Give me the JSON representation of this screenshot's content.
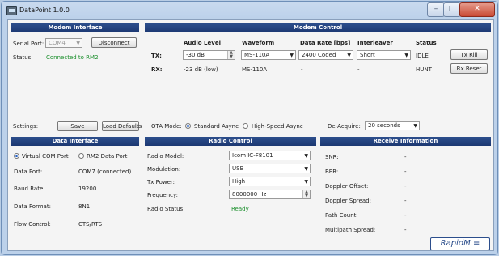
{
  "window": {
    "title": "DataPoint 1.0.0"
  },
  "modem_interface": {
    "header": "Modem Interface",
    "serial_port_label": "Serial Port:",
    "serial_port_value": "COM4",
    "disconnect_label": "Disconnect",
    "status_label": "Status:",
    "status_value": "Connected to RM2.",
    "settings_label": "Settings:",
    "save_label": "Save",
    "load_defaults_label": "Load Defaults"
  },
  "modem_control": {
    "header": "Modem Control",
    "columns": {
      "audio_level": "Audio Level",
      "waveform": "Waveform",
      "data_rate": "Data Rate [bps]",
      "interleaver": "Interleaver",
      "status": "Status"
    },
    "tx": {
      "label": "TX:",
      "audio_level": "-30 dB",
      "waveform": "MS-110A",
      "data_rate": "2400 Coded",
      "interleaver": "Short",
      "status": "IDLE",
      "button": "Tx Kill"
    },
    "rx": {
      "label": "RX:",
      "audio_level": "-23 dB (low)",
      "waveform": "MS-110A",
      "data_rate": "-",
      "interleaver": "-",
      "status": "HUNT",
      "button": "Rx Reset"
    },
    "ota_mode_label": "OTA Mode:",
    "ota_standard": "Standard Async",
    "ota_high_speed": "High-Speed Async",
    "deacquire_label": "De-Acquire:",
    "deacquire_value": "20 seconds"
  },
  "data_interface": {
    "header": "Data Interface",
    "virtual_com": "Virtual COM Port",
    "rm2_data_port": "RM2 Data Port",
    "data_port_label": "Data Port:",
    "data_port_value": "COM7 (connected)",
    "baud_rate_label": "Baud Rate:",
    "baud_rate_value": "19200",
    "data_format_label": "Data Format:",
    "data_format_value": "8N1",
    "flow_control_label": "Flow Control:",
    "flow_control_value": "CTS/RTS"
  },
  "radio_control": {
    "header": "Radio Control",
    "radio_model_label": "Radio Model:",
    "radio_model_value": "Icom IC-F8101",
    "modulation_label": "Modulation:",
    "modulation_value": "USB",
    "tx_power_label": "Tx Power:",
    "tx_power_value": "High",
    "frequency_label": "Frequency:",
    "frequency_value": "8000000 Hz",
    "radio_status_label": "Radio Status:",
    "radio_status_value": "Ready"
  },
  "receive_info": {
    "header": "Receive Information",
    "rows": [
      {
        "label": "SNR:",
        "value": "-"
      },
      {
        "label": "BER:",
        "value": "-"
      },
      {
        "label": "Doppler Offset:",
        "value": "-"
      },
      {
        "label": "Doppler Spread:",
        "value": "-"
      },
      {
        "label": "Path Count:",
        "value": "-"
      },
      {
        "label": "Multipath Spread:",
        "value": "-"
      }
    ]
  },
  "logo": {
    "text": "RapidM"
  },
  "icons": {
    "app": "app-icon",
    "minimize": "minimize-icon",
    "maximize": "maximize-icon",
    "close": "close-icon",
    "dropdown": "chevron-down-icon",
    "spinner": "spinner-icon"
  }
}
